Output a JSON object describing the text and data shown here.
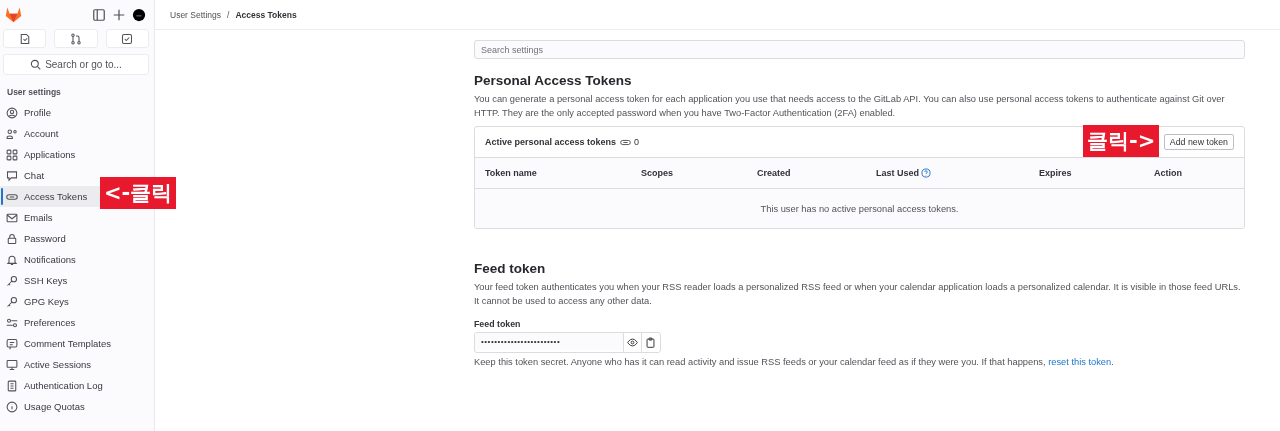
{
  "sidebar": {
    "search": {
      "placeholder": "Search or go to..."
    },
    "section_title": "User settings",
    "items": [
      {
        "label": "Profile",
        "selected": false
      },
      {
        "label": "Account",
        "selected": false
      },
      {
        "label": "Applications",
        "selected": false
      },
      {
        "label": "Chat",
        "selected": false
      },
      {
        "label": "Access Tokens",
        "selected": true
      },
      {
        "label": "Emails",
        "selected": false
      },
      {
        "label": "Password",
        "selected": false
      },
      {
        "label": "Notifications",
        "selected": false
      },
      {
        "label": "SSH Keys",
        "selected": false
      },
      {
        "label": "GPG Keys",
        "selected": false
      },
      {
        "label": "Preferences",
        "selected": false
      },
      {
        "label": "Comment Templates",
        "selected": false
      },
      {
        "label": "Active Sessions",
        "selected": false
      },
      {
        "label": "Authentication Log",
        "selected": false
      },
      {
        "label": "Usage Quotas",
        "selected": false
      }
    ]
  },
  "breadcrumb": [
    "User Settings",
    "/",
    "Access Tokens"
  ],
  "search_settings": {
    "placeholder": "Search settings"
  },
  "personal_tokens": {
    "title": "Personal Access Tokens",
    "description": "You can generate a personal access token for each application you use that needs access to the GitLab API. You can also use personal access tokens to authenticate against Git over HTTP. They are the only accepted password when you have Two-Factor Authentication (2FA) enabled.",
    "card_title": "Active personal access tokens",
    "count": "0",
    "add_button": "Add new token",
    "columns": [
      {
        "label": "Token name",
        "help": false
      },
      {
        "label": "Scopes",
        "help": false
      },
      {
        "label": "Created",
        "help": false
      },
      {
        "label": "Last Used",
        "help": true
      },
      {
        "label": "Expires",
        "help": false
      },
      {
        "label": "Action",
        "help": false
      }
    ],
    "empty_message": "This user has no active personal access tokens."
  },
  "feed_token": {
    "title": "Feed token",
    "description": "Your feed token authenticates you when your RSS reader loads a personalized RSS feed or when your calendar application loads a personalized calendar. It is visible in those feed URLs. It cannot be used to access any other data.",
    "field_label": "Feed token",
    "value": "••••••••••••••••••••••••",
    "help_text": "Keep this token secret. Anyone who has it can read activity and issue RSS feeds or your calendar feed as if they were you. If that happens, ",
    "help_link": "reset this token",
    "help_end": "."
  },
  "annotations": [
    {
      "text": "<-클릭"
    },
    {
      "text": "클릭->"
    }
  ]
}
